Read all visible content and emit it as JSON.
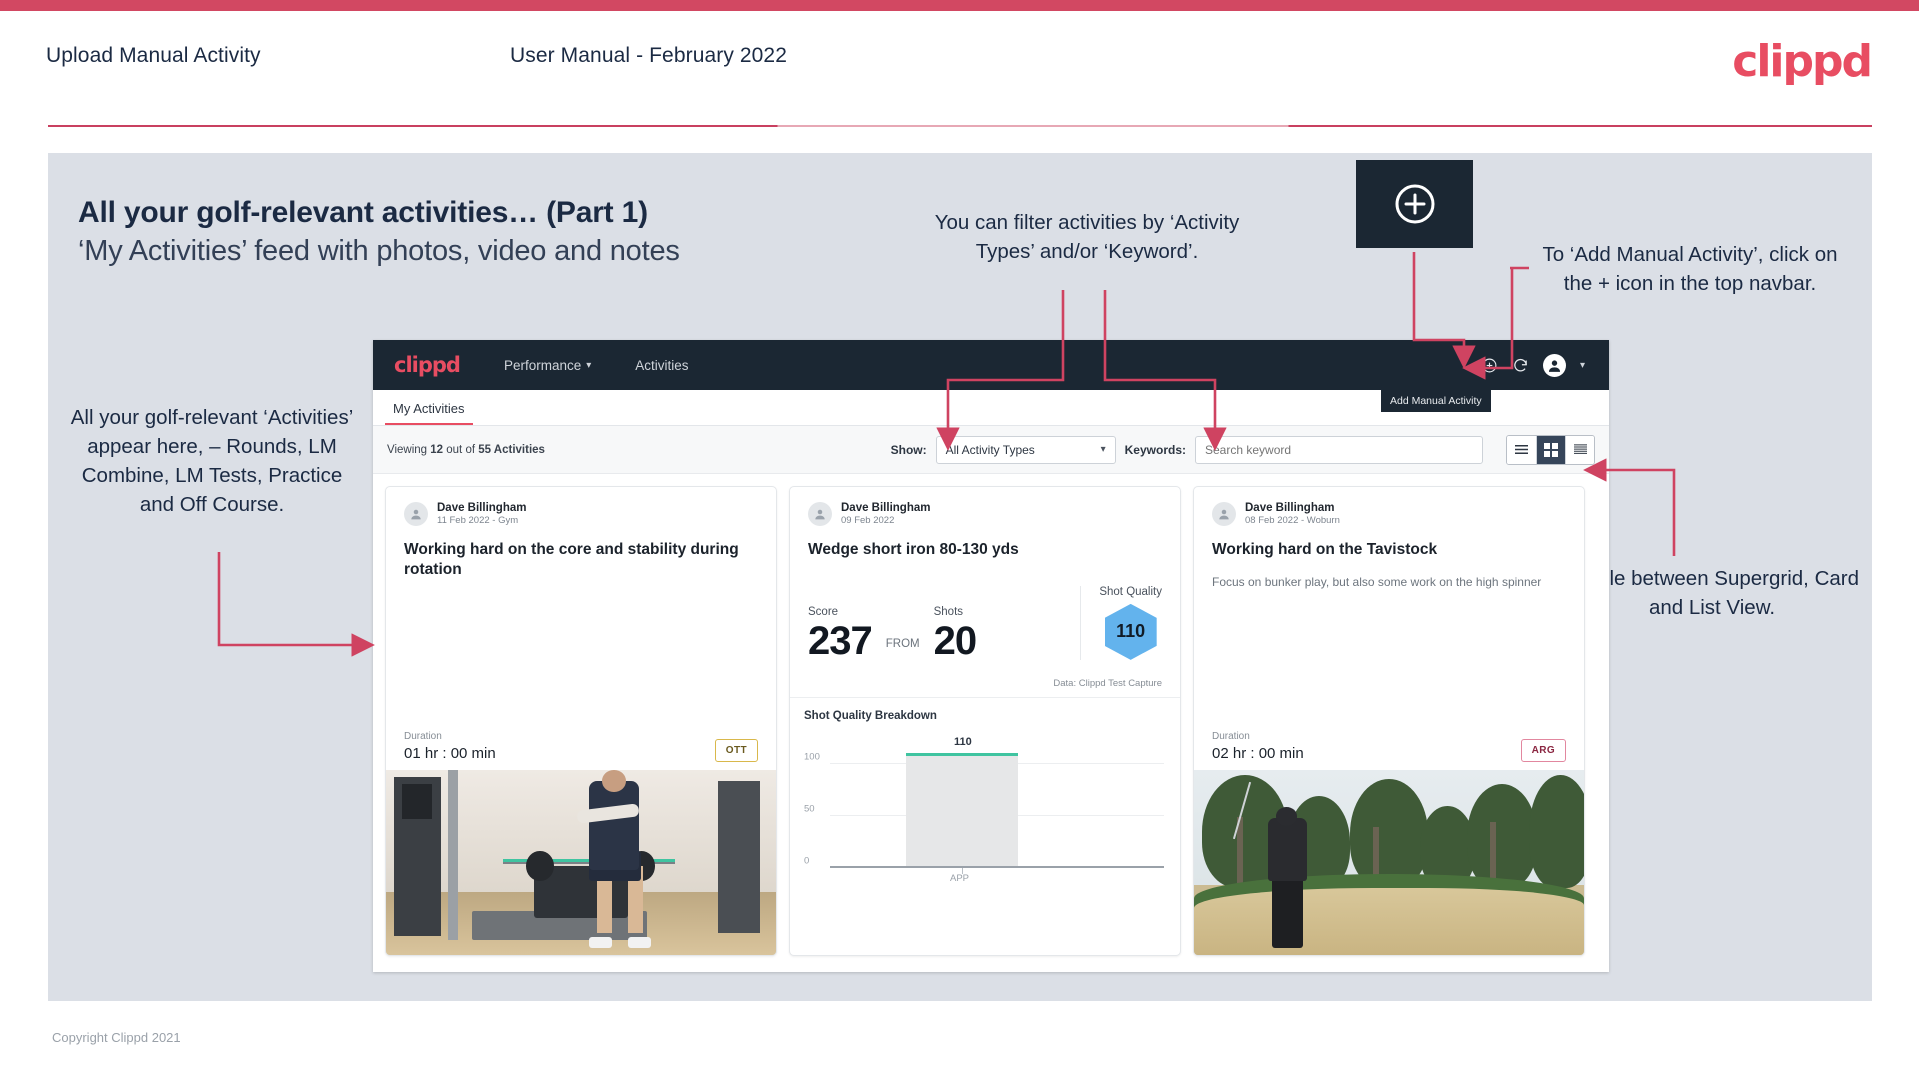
{
  "header": {
    "title": "Upload Manual Activity",
    "subtitle": "User Manual - February 2022",
    "brand": "clippd"
  },
  "slide": {
    "heading": "All your golf-relevant activities… (Part 1)",
    "subheading": "‘My Activities’ feed with photos, video and notes"
  },
  "callouts": {
    "filter": "You can filter activities by ‘Activity Types’ and/or ‘Keyword’.",
    "add_manual": "To ‘Add Manual Activity’, click on the + icon in the top navbar.",
    "feed": "All your golf-relevant ‘Activities’ appear here, – Rounds, LM Combine, LM Tests, Practice and Off Course.",
    "toggle": "Toggle between Supergrid, Card and List View."
  },
  "app": {
    "navbar": {
      "logo": "clippd",
      "links": [
        {
          "label": "Performance",
          "has_caret": true
        },
        {
          "label": "Activities",
          "has_caret": false
        }
      ],
      "add_icon": "plus-circle-icon",
      "refresh_icon": "refresh-icon",
      "avatar_icon": "user-avatar-icon",
      "tooltip": "Add Manual Activity"
    },
    "tab": "My Activities",
    "filterbar": {
      "viewing_prefix": "Viewing ",
      "viewing_count": "12",
      "viewing_middle": " out of ",
      "viewing_total": "55 Activities",
      "show_label": "Show:",
      "activity_type_value": "All Activity Types",
      "keywords_label": "Keywords:",
      "keyword_placeholder": "Search keyword",
      "view_modes": [
        "list-view-icon",
        "supergrid-view-icon",
        "card-view-icon"
      ],
      "active_view": "supergrid-view-icon"
    },
    "cards": [
      {
        "author": "Dave Billingham",
        "meta": "11 Feb 2022 - Gym",
        "title": "Working hard on the core and stability during rotation",
        "note": "",
        "duration_label": "Duration",
        "duration_value": "01 hr : 00 min",
        "chip": "OTT",
        "chip_style": "ott",
        "media": "gym-video-thumbnail"
      },
      {
        "author": "Dave Billingham",
        "meta": "09 Feb 2022",
        "title": "Wedge short iron 80-130 yds",
        "score_label": "Score",
        "score_value": "237",
        "from_word": "FROM",
        "shots_label": "Shots",
        "shots_value": "20",
        "shot_quality_label": "Shot Quality",
        "shot_quality_value": "110",
        "data_source": "Data: Clippd Test Capture"
      },
      {
        "author": "Dave Billingham",
        "meta": "08 Feb 2022 - Woburn",
        "title": "Working hard on the Tavistock",
        "note": "Focus on bunker play, but also some work on the high spinner",
        "duration_label": "Duration",
        "duration_value": "02 hr : 00 min",
        "chip": "ARG",
        "chip_style": "arg",
        "media": "bunker-photo-thumbnail"
      }
    ]
  },
  "chart_data": {
    "type": "bar",
    "title": "Shot Quality Breakdown",
    "categories": [
      "APP"
    ],
    "values": [
      110
    ],
    "data_labels": [
      "110"
    ],
    "yticks": [
      "0",
      "50",
      "100"
    ],
    "ylim": [
      0,
      125
    ],
    "xlabel": "",
    "ylabel": "",
    "grid": true,
    "bar_color": "#e6e7e8",
    "bar_cap_color": "#3fc4a0",
    "legend": "none"
  },
  "colors": {
    "brand_red": "#e84d62",
    "rule_red": "#c94060",
    "navy": "#1b2a43",
    "panel_bg": "#dbdfe6",
    "app_dark": "#1b2733",
    "arrow_red": "#cf4361",
    "shot_quality_blue": "#63b3ed",
    "bar_cap_teal": "#3fc4a0"
  },
  "footer": "Copyright Clippd 2021"
}
